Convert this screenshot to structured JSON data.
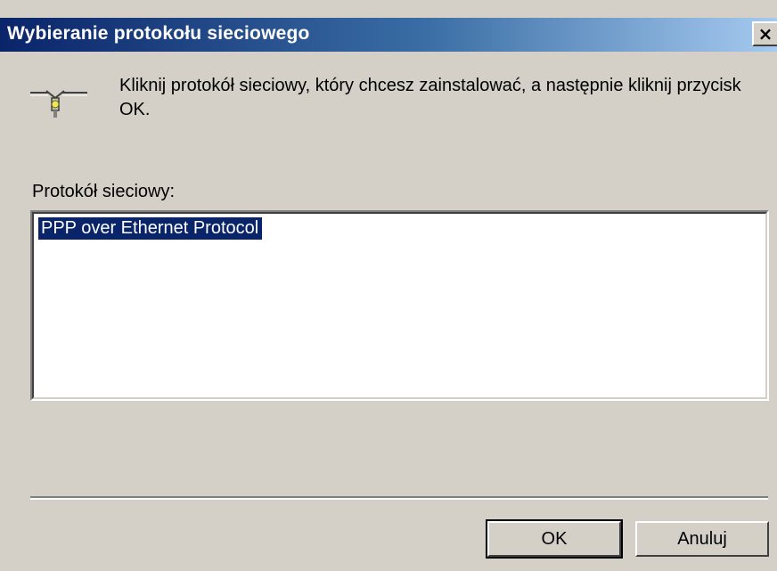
{
  "dialog": {
    "title": "Wybieranie protokołu sieciowego",
    "close_label": "×",
    "icon": "network-protocol-icon",
    "instruction": "Kliknij protokół sieciowy, który chcesz zainstalować, a następnie kliknij przycisk OK.",
    "list_label": "Protokół sieciowy:",
    "list_items": [
      {
        "label": "PPP over Ethernet Protocol",
        "selected": true
      }
    ],
    "buttons": {
      "ok_label": "OK",
      "cancel_label": "Anuluj"
    }
  },
  "colors": {
    "title_bar_start": "#0a246a",
    "title_bar_end": "#a6caf0",
    "window_face": "#d4d0c8",
    "selection": "#0a246a"
  }
}
